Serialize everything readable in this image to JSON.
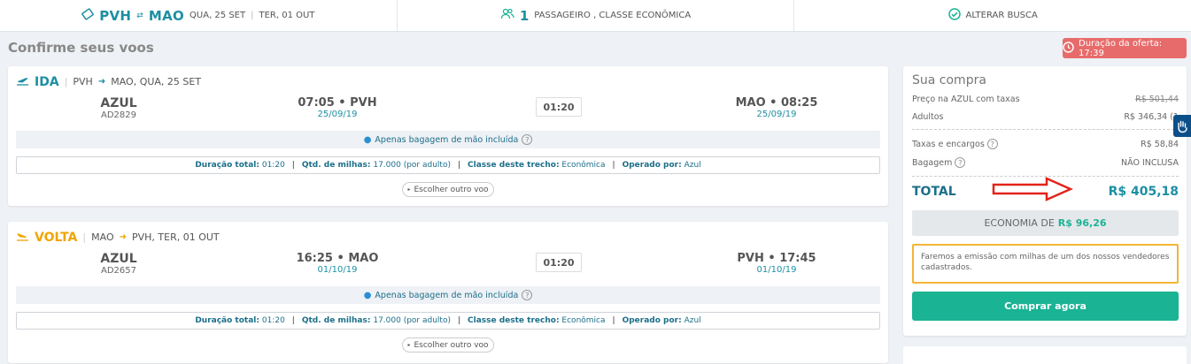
{
  "topbar": {
    "origin": "PVH",
    "destination": "MAO",
    "swap_symbol": "⇄",
    "outbound_date": "QUA, 25 SET",
    "date_separator": "|",
    "return_date": "TER, 01 OUT",
    "passenger_count": "1",
    "passenger_text": "PASSAGEIRO , CLASSE ECONÔMICA",
    "change_search": "ALTERAR BUSCA"
  },
  "page_title": "Confirme seus voos",
  "offer_badge": "Duração da oferta: 17:39",
  "flights": [
    {
      "direction": "IDA",
      "route_from": "PVH",
      "route_to": "MAO, QUA, 25 SET",
      "airline": "AZUL",
      "flight_number": "AD2829",
      "departure": "07:05 • PVH",
      "departure_date": "25/09/19",
      "duration": "01:20",
      "arrival": "MAO • 08:25",
      "arrival_date": "25/09/19",
      "baggage": "Apenas bagagem de mão incluída",
      "details": {
        "duration_label": "Duração total:",
        "duration_value": "01:20",
        "miles_label": "Qtd. de milhas:",
        "miles_value": "17.000 (por adulto)",
        "class_label": "Classe deste trecho:",
        "class_value": "Econômica",
        "operator_label": "Operado por:",
        "operator_value": "Azul"
      },
      "choose_other": "Escolher outro voo"
    },
    {
      "direction": "VOLTA",
      "route_from": "MAO",
      "route_to": "PVH, TER, 01 OUT",
      "airline": "AZUL",
      "flight_number": "AD2657",
      "departure": "16:25 • MAO",
      "departure_date": "01/10/19",
      "duration": "01:20",
      "arrival": "PVH • 17:45",
      "arrival_date": "01/10/19",
      "baggage": "Apenas bagagem de mão incluída",
      "details": {
        "duration_label": "Duração total:",
        "duration_value": "01:20",
        "miles_label": "Qtd. de milhas:",
        "miles_value": "17.000 (por adulto)",
        "class_label": "Classe deste trecho:",
        "class_value": "Econômica",
        "operator_label": "Operado por:",
        "operator_value": "Azul"
      },
      "choose_other": "Escolher outro voo"
    }
  ],
  "purchase": {
    "title": "Sua compra",
    "price_label": "Preço na AZUL com taxas",
    "price_value": "R$ 501,44",
    "adults_label": "Adultos",
    "adults_value": "R$ 346,34 (1",
    "fees_label": "Taxas e encargos",
    "fees_value": "R$ 58,84",
    "baggage_label": "Bagagem",
    "baggage_value": "NÃO INCLUSA",
    "total_label": "TOTAL",
    "total_value": "R$ 405,18",
    "savings_prefix": "ECONOMIA DE",
    "savings_value": "R$ 96,26",
    "notice": "Faremos a emissão com milhas de um dos nossos vendedores cadastrados.",
    "buy_button": "Comprar agora"
  },
  "colors": {
    "teal": "#1c8fa3",
    "green": "#1ab394",
    "volta_orange": "#f0a500",
    "badge_red": "#e86b6b",
    "arrow_red": "#e2231a"
  }
}
